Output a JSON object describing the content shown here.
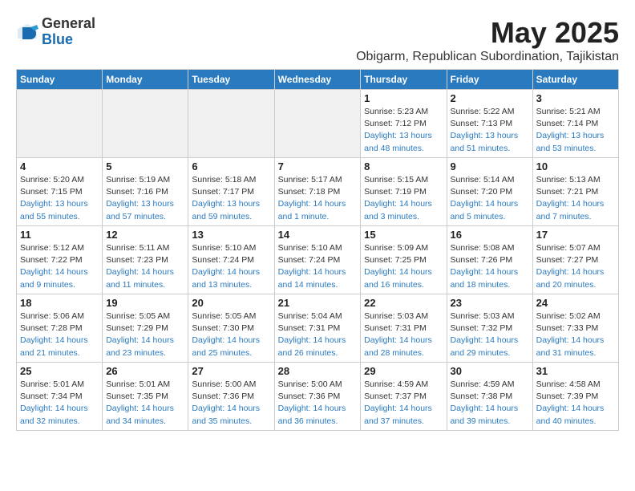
{
  "header": {
    "logo_general": "General",
    "logo_blue": "Blue",
    "month": "May 2025",
    "location": "Obigarm, Republican Subordination, Tajikistan"
  },
  "weekdays": [
    "Sunday",
    "Monday",
    "Tuesday",
    "Wednesday",
    "Thursday",
    "Friday",
    "Saturday"
  ],
  "weeks": [
    [
      {
        "day": "",
        "info": ""
      },
      {
        "day": "",
        "info": ""
      },
      {
        "day": "",
        "info": ""
      },
      {
        "day": "",
        "info": ""
      },
      {
        "day": "1",
        "sunrise": "Sunrise: 5:23 AM",
        "sunset": "Sunset: 7:12 PM",
        "daylight": "Daylight: 13 hours and 48 minutes."
      },
      {
        "day": "2",
        "sunrise": "Sunrise: 5:22 AM",
        "sunset": "Sunset: 7:13 PM",
        "daylight": "Daylight: 13 hours and 51 minutes."
      },
      {
        "day": "3",
        "sunrise": "Sunrise: 5:21 AM",
        "sunset": "Sunset: 7:14 PM",
        "daylight": "Daylight: 13 hours and 53 minutes."
      }
    ],
    [
      {
        "day": "4",
        "sunrise": "Sunrise: 5:20 AM",
        "sunset": "Sunset: 7:15 PM",
        "daylight": "Daylight: 13 hours and 55 minutes."
      },
      {
        "day": "5",
        "sunrise": "Sunrise: 5:19 AM",
        "sunset": "Sunset: 7:16 PM",
        "daylight": "Daylight: 13 hours and 57 minutes."
      },
      {
        "day": "6",
        "sunrise": "Sunrise: 5:18 AM",
        "sunset": "Sunset: 7:17 PM",
        "daylight": "Daylight: 13 hours and 59 minutes."
      },
      {
        "day": "7",
        "sunrise": "Sunrise: 5:17 AM",
        "sunset": "Sunset: 7:18 PM",
        "daylight": "Daylight: 14 hours and 1 minute."
      },
      {
        "day": "8",
        "sunrise": "Sunrise: 5:15 AM",
        "sunset": "Sunset: 7:19 PM",
        "daylight": "Daylight: 14 hours and 3 minutes."
      },
      {
        "day": "9",
        "sunrise": "Sunrise: 5:14 AM",
        "sunset": "Sunset: 7:20 PM",
        "daylight": "Daylight: 14 hours and 5 minutes."
      },
      {
        "day": "10",
        "sunrise": "Sunrise: 5:13 AM",
        "sunset": "Sunset: 7:21 PM",
        "daylight": "Daylight: 14 hours and 7 minutes."
      }
    ],
    [
      {
        "day": "11",
        "sunrise": "Sunrise: 5:12 AM",
        "sunset": "Sunset: 7:22 PM",
        "daylight": "Daylight: 14 hours and 9 minutes."
      },
      {
        "day": "12",
        "sunrise": "Sunrise: 5:11 AM",
        "sunset": "Sunset: 7:23 PM",
        "daylight": "Daylight: 14 hours and 11 minutes."
      },
      {
        "day": "13",
        "sunrise": "Sunrise: 5:10 AM",
        "sunset": "Sunset: 7:24 PM",
        "daylight": "Daylight: 14 hours and 13 minutes."
      },
      {
        "day": "14",
        "sunrise": "Sunrise: 5:10 AM",
        "sunset": "Sunset: 7:24 PM",
        "daylight": "Daylight: 14 hours and 14 minutes."
      },
      {
        "day": "15",
        "sunrise": "Sunrise: 5:09 AM",
        "sunset": "Sunset: 7:25 PM",
        "daylight": "Daylight: 14 hours and 16 minutes."
      },
      {
        "day": "16",
        "sunrise": "Sunrise: 5:08 AM",
        "sunset": "Sunset: 7:26 PM",
        "daylight": "Daylight: 14 hours and 18 minutes."
      },
      {
        "day": "17",
        "sunrise": "Sunrise: 5:07 AM",
        "sunset": "Sunset: 7:27 PM",
        "daylight": "Daylight: 14 hours and 20 minutes."
      }
    ],
    [
      {
        "day": "18",
        "sunrise": "Sunrise: 5:06 AM",
        "sunset": "Sunset: 7:28 PM",
        "daylight": "Daylight: 14 hours and 21 minutes."
      },
      {
        "day": "19",
        "sunrise": "Sunrise: 5:05 AM",
        "sunset": "Sunset: 7:29 PM",
        "daylight": "Daylight: 14 hours and 23 minutes."
      },
      {
        "day": "20",
        "sunrise": "Sunrise: 5:05 AM",
        "sunset": "Sunset: 7:30 PM",
        "daylight": "Daylight: 14 hours and 25 minutes."
      },
      {
        "day": "21",
        "sunrise": "Sunrise: 5:04 AM",
        "sunset": "Sunset: 7:31 PM",
        "daylight": "Daylight: 14 hours and 26 minutes."
      },
      {
        "day": "22",
        "sunrise": "Sunrise: 5:03 AM",
        "sunset": "Sunset: 7:31 PM",
        "daylight": "Daylight: 14 hours and 28 minutes."
      },
      {
        "day": "23",
        "sunrise": "Sunrise: 5:03 AM",
        "sunset": "Sunset: 7:32 PM",
        "daylight": "Daylight: 14 hours and 29 minutes."
      },
      {
        "day": "24",
        "sunrise": "Sunrise: 5:02 AM",
        "sunset": "Sunset: 7:33 PM",
        "daylight": "Daylight: 14 hours and 31 minutes."
      }
    ],
    [
      {
        "day": "25",
        "sunrise": "Sunrise: 5:01 AM",
        "sunset": "Sunset: 7:34 PM",
        "daylight": "Daylight: 14 hours and 32 minutes."
      },
      {
        "day": "26",
        "sunrise": "Sunrise: 5:01 AM",
        "sunset": "Sunset: 7:35 PM",
        "daylight": "Daylight: 14 hours and 34 minutes."
      },
      {
        "day": "27",
        "sunrise": "Sunrise: 5:00 AM",
        "sunset": "Sunset: 7:36 PM",
        "daylight": "Daylight: 14 hours and 35 minutes."
      },
      {
        "day": "28",
        "sunrise": "Sunrise: 5:00 AM",
        "sunset": "Sunset: 7:36 PM",
        "daylight": "Daylight: 14 hours and 36 minutes."
      },
      {
        "day": "29",
        "sunrise": "Sunrise: 4:59 AM",
        "sunset": "Sunset: 7:37 PM",
        "daylight": "Daylight: 14 hours and 37 minutes."
      },
      {
        "day": "30",
        "sunrise": "Sunrise: 4:59 AM",
        "sunset": "Sunset: 7:38 PM",
        "daylight": "Daylight: 14 hours and 39 minutes."
      },
      {
        "day": "31",
        "sunrise": "Sunrise: 4:58 AM",
        "sunset": "Sunset: 7:39 PM",
        "daylight": "Daylight: 14 hours and 40 minutes."
      }
    ]
  ]
}
